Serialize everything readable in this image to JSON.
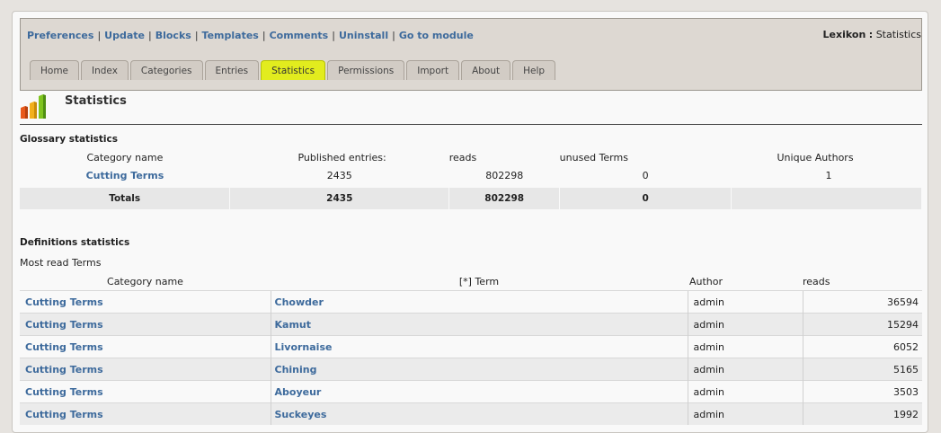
{
  "topnav": {
    "links": [
      "Preferences",
      "Update",
      "Blocks",
      "Templates",
      "Comments",
      "Uninstall",
      "Go to module"
    ],
    "separator": "|"
  },
  "breadcrumb": {
    "module": "Lexikon",
    "sep": ":",
    "page": "Statistics"
  },
  "tabs": [
    "Home",
    "Index",
    "Categories",
    "Entries",
    "Statistics",
    "Permissions",
    "Import",
    "About",
    "Help"
  ],
  "active_tab": "Statistics",
  "page": {
    "title": "Statistics",
    "icon": "bar-chart-icon"
  },
  "glossary": {
    "title": "Glossary statistics",
    "headers": [
      "Category name",
      "Published entries:",
      "reads",
      "unused Terms",
      "Unique Authors"
    ],
    "row": [
      "Cutting Terms",
      "2435",
      "802298",
      "0",
      "1"
    ],
    "totals": [
      "Totals",
      "2435",
      "802298",
      "0",
      ""
    ]
  },
  "definitions": {
    "title": "Definitions statistics",
    "subtitle": "Most read Terms",
    "headers": [
      "Category name",
      "[*] Term",
      "Author",
      "reads"
    ],
    "rows": [
      [
        "Cutting Terms",
        "Chowder",
        "admin",
        "36594"
      ],
      [
        "Cutting Terms",
        "Kamut",
        "admin",
        "15294"
      ],
      [
        "Cutting Terms",
        "Livornaise",
        "admin",
        "6052"
      ],
      [
        "Cutting Terms",
        "Chining",
        "admin",
        "5165"
      ],
      [
        "Cutting Terms",
        "Aboyeur",
        "admin",
        "3503"
      ],
      [
        "Cutting Terms",
        "Suckeyes",
        "admin",
        "1992"
      ]
    ]
  },
  "colors": {
    "link": "#3d6a9c",
    "active_tab": "#e2ec1e",
    "admin_bar": "#ddd8d2"
  }
}
